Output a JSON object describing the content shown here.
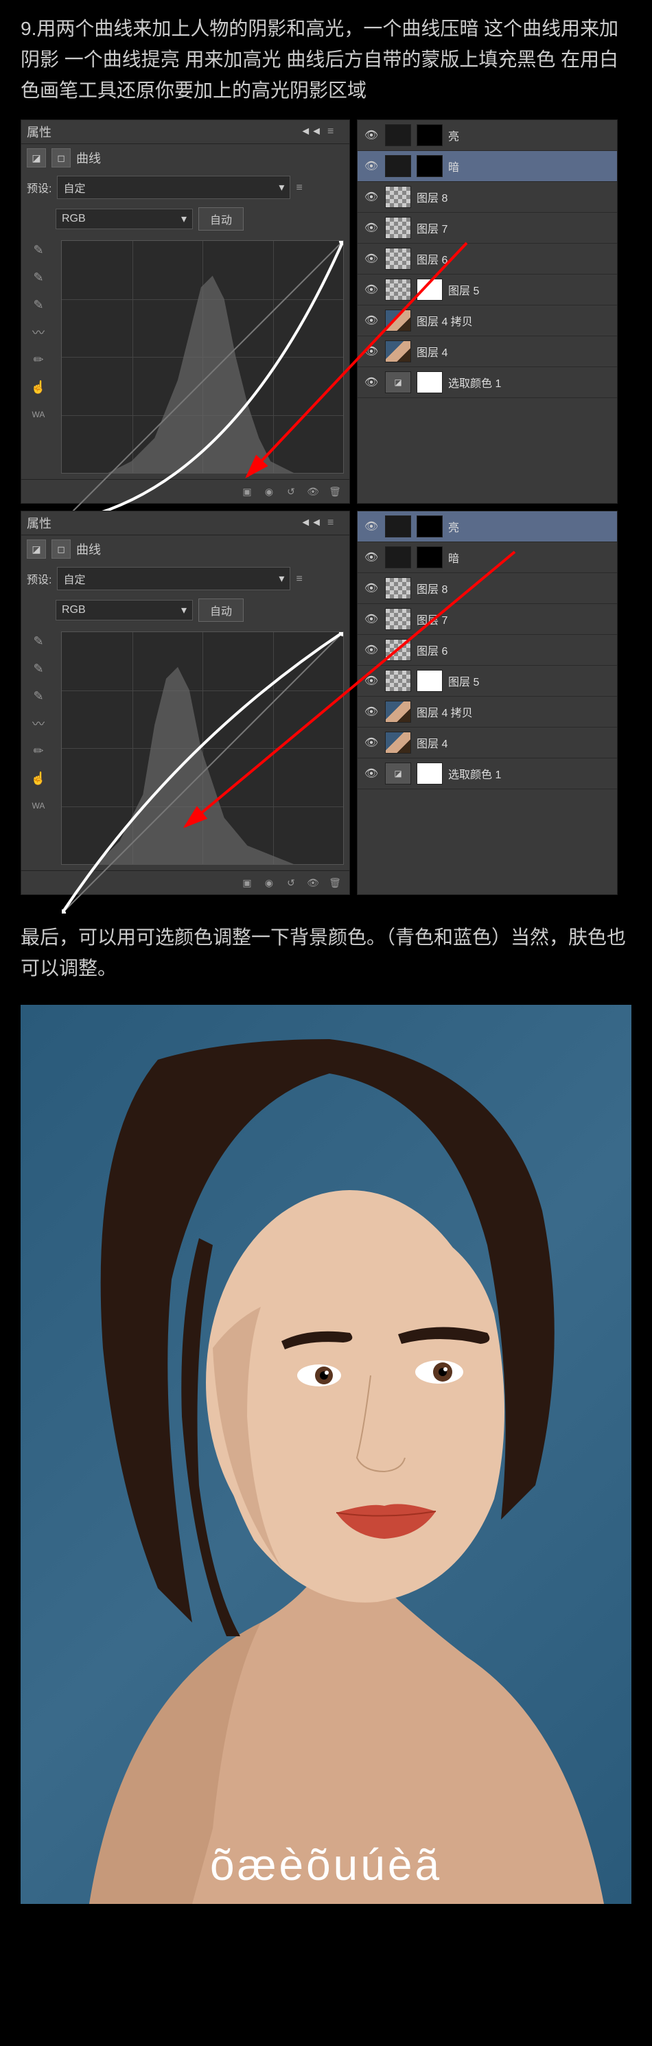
{
  "step": {
    "number": "9.",
    "text": "用两个曲线来加上人物的阴影和高光，一个曲线压暗 这个曲线用来加阴影 一个曲线提亮 用来加高光 曲线后方自带的蒙版上填充黑色 在用白色画笔工具还原你要加上的高光阴影区域"
  },
  "panel1": {
    "props_title": "属性",
    "curve_label": "曲线",
    "preset_label": "预设:",
    "preset_value": "自定",
    "channel": "RGB",
    "auto": "自动",
    "layers": [
      {
        "name": "亮",
        "thumb": "dark",
        "mask": true
      },
      {
        "name": "暗",
        "thumb": "dark",
        "mask": true,
        "selected": true
      },
      {
        "name": "图层 8",
        "thumb": "checker"
      },
      {
        "name": "图层 7",
        "thumb": "checker"
      },
      {
        "name": "图层 6",
        "thumb": "checker"
      },
      {
        "name": "图层 5",
        "thumb": "checker",
        "mask_white": true
      },
      {
        "name": "图层 4 拷贝",
        "thumb": "portrait"
      },
      {
        "name": "图层 4",
        "thumb": "portrait"
      },
      {
        "name": "选取颜色 1",
        "thumb": "adj",
        "mask_white": true
      }
    ]
  },
  "panel2": {
    "props_title": "属性",
    "curve_label": "曲线",
    "preset_label": "预设:",
    "preset_value": "自定",
    "channel": "RGB",
    "auto": "自动",
    "layers": [
      {
        "name": "亮",
        "thumb": "dark",
        "mask": true,
        "selected": true
      },
      {
        "name": "暗",
        "thumb": "dark",
        "mask": true
      },
      {
        "name": "图层 8",
        "thumb": "checker"
      },
      {
        "name": "图层 7",
        "thumb": "checker"
      },
      {
        "name": "图层 6",
        "thumb": "checker"
      },
      {
        "name": "图层 5",
        "thumb": "checker",
        "mask_white": true
      },
      {
        "name": "图层 4 拷贝",
        "thumb": "portrait"
      },
      {
        "name": "图层 4",
        "thumb": "portrait"
      },
      {
        "name": "选取颜色 1",
        "thumb": "adj",
        "mask_white": true
      }
    ]
  },
  "final_text": "最后，可以用可选颜色调整一下背景颜色。（青色和蓝色）当然，肤色也可以调整。",
  "watermark": "õæèõuúèã"
}
